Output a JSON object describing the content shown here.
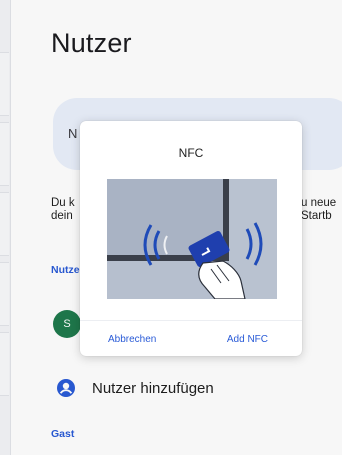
{
  "page": {
    "title": "Nutzer"
  },
  "name_card": {
    "initial": "N"
  },
  "description": {
    "left": "Du k\ndein",
    "right": "u neue\nStartb"
  },
  "sections": {
    "users_label": "Nutze",
    "guest_label": "Gast"
  },
  "current_user": {
    "avatar_letter": "S"
  },
  "add_user": {
    "label": "Nutzer hinzufügen"
  },
  "dialog": {
    "title": "NFC",
    "cancel_label": "Abbrechen",
    "confirm_label": "Add NFC"
  },
  "colors": {
    "accent": "#2a5bd7",
    "avatar_bg": "#1f7a4d",
    "card_bg": "#eaf0fb"
  }
}
